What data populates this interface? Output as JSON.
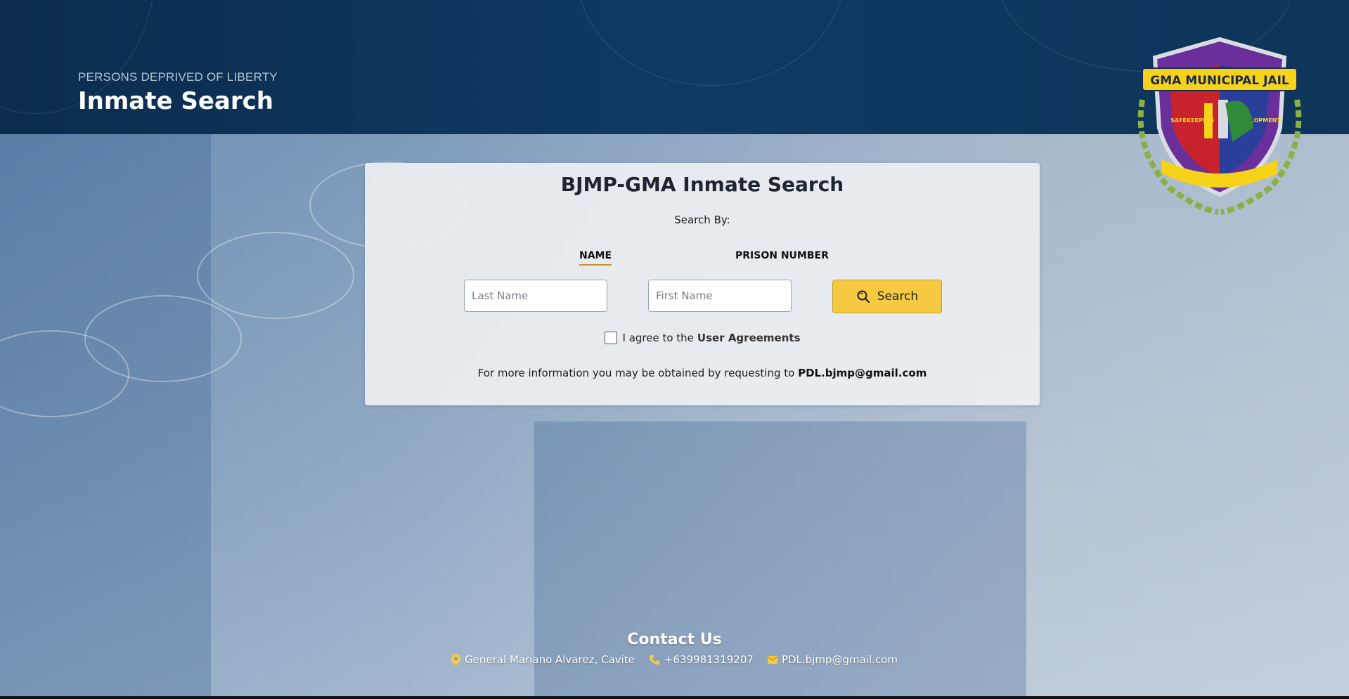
{
  "header": {
    "subtitle": "PERSONS DEPRIVED OF LIBERTY",
    "title": "Inmate Search",
    "logo": {
      "banner_text": "GMA MUNICIPAL JAIL",
      "left_text": "SAFEKEEPING",
      "right_text": "DEVELOPMENT"
    }
  },
  "card": {
    "title": "BJMP-GMA Inmate Search",
    "search_by": "Search By:",
    "tabs": [
      {
        "label": "NAME",
        "active": true
      },
      {
        "label": "PRISON NUMBER",
        "active": false
      }
    ],
    "last_name_placeholder": "Last Name",
    "first_name_placeholder": "First Name",
    "search_label": "Search",
    "agree_text": "I agree to the",
    "agree_link": "User Agreements",
    "info_text": "For more information you may be obtained by requesting to",
    "info_email": "PDL.bjmp@gmail.com"
  },
  "footer": {
    "title": "Contact Us",
    "address": "General Mariano Alvarez, Cavite",
    "phone": "+639981319207",
    "email": "PDL.bjmp@gmail.com"
  },
  "colors": {
    "header_bg": "#0b2c4e",
    "accent": "#f6c942",
    "tab_underline": "#d4922a"
  }
}
